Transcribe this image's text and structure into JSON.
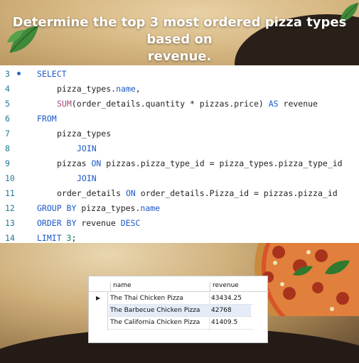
{
  "title": {
    "line1": "Determine the top 3 most ordered pizza types based on",
    "line2": "revenue."
  },
  "editor": {
    "lines": [
      {
        "num": "3",
        "has_breakpoint": true
      },
      {
        "num": "4"
      },
      {
        "num": "5"
      },
      {
        "num": "6"
      },
      {
        "num": "7"
      },
      {
        "num": "8"
      },
      {
        "num": "9"
      },
      {
        "num": "10"
      },
      {
        "num": "11"
      },
      {
        "num": "12"
      },
      {
        "num": "13"
      },
      {
        "num": "14"
      }
    ],
    "tokens": {
      "l3_kw": "SELECT",
      "l4": "pizza_types.",
      "l4_kw": "name",
      "l4_tail": ",",
      "l5_fn": "SUM",
      "l5": "(order_details.quantity * pizzas.price) ",
      "l5_kw": "AS",
      "l5_tail": " revenue",
      "l6_kw": "FROM",
      "l7": "pizza_types",
      "l8_kw": "JOIN",
      "l9": "pizzas ",
      "l9_kw": "ON",
      "l9_tail": " pizzas.pizza_type_id = pizza_types.pizza_type_id",
      "l10_kw": "JOIN",
      "l11": "order_details ",
      "l11_kw": "ON",
      "l11_tail": " order_details.Pizza_id = pizzas.pizza_id",
      "l12_kw": "GROUP BY",
      "l12": " pizza_types.",
      "l12_kw2": "name",
      "l13_kw": "ORDER BY",
      "l13": " revenue ",
      "l13_kw2": "DESC",
      "l14_kw": "LIMIT",
      "l14_num": " 3",
      "l14_tail": ";"
    }
  },
  "result_grid": {
    "columns": [
      "name",
      "revenue"
    ],
    "rows": [
      {
        "name": "The Thai Chicken Pizza",
        "revenue": "43434.25",
        "current": true
      },
      {
        "name": "The Barbecue Chicken Pizza",
        "revenue": "42768"
      },
      {
        "name": "The California Chicken Pizza",
        "revenue": "41409.5"
      }
    ],
    "current_row_indicator": "▶"
  },
  "colors": {
    "keyword": "#1d59c7",
    "function": "#a24d7d",
    "line_number": "#237893",
    "selection": "#e4ecf8"
  },
  "icons": [
    "basil-leaf-icon",
    "pizza-image",
    "breakpoint-dot-icon",
    "row-pointer-icon"
  ]
}
